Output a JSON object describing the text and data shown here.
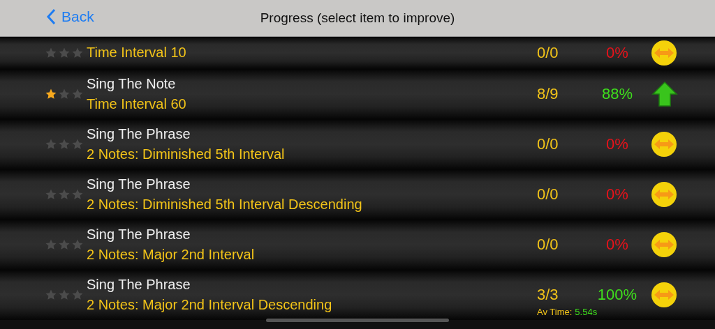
{
  "nav": {
    "back": "Back",
    "title": "Progress (select item to improve)"
  },
  "rows": [
    {
      "stars": 0,
      "subtitle": "Time Interval 10",
      "score": "0/0",
      "percent": "0%",
      "color": "#e8121a",
      "kind": "same"
    },
    {
      "stars": 1,
      "title": "Sing The Note",
      "subtitle": "Time Interval 60",
      "score": "8/9",
      "percent": "88%",
      "color": "#3ee01c",
      "kind": "up"
    },
    {
      "stars": 0,
      "title": "Sing The Phrase",
      "subtitle": "2 Notes: Diminished 5th Interval",
      "score": "0/0",
      "percent": "0%",
      "color": "#e8121a",
      "kind": "same"
    },
    {
      "stars": 0,
      "title": "Sing The Phrase",
      "subtitle": "2 Notes: Diminished 5th Interval Descending",
      "score": "0/0",
      "percent": "0%",
      "color": "#e8121a",
      "kind": "same"
    },
    {
      "stars": 0,
      "title": "Sing The Phrase",
      "subtitle": "2 Notes: Major 2nd Interval",
      "score": "0/0",
      "percent": "0%",
      "color": "#e8121a",
      "kind": "same"
    },
    {
      "stars": 0,
      "title": "Sing The Phrase",
      "subtitle": "2 Notes: Major 2nd Interval Descending",
      "score": "3/3",
      "percent": "100%",
      "color": "#3ee01c",
      "kind": "same",
      "av_time_label": "Av Time:",
      "av_time": "5.54s"
    }
  ]
}
